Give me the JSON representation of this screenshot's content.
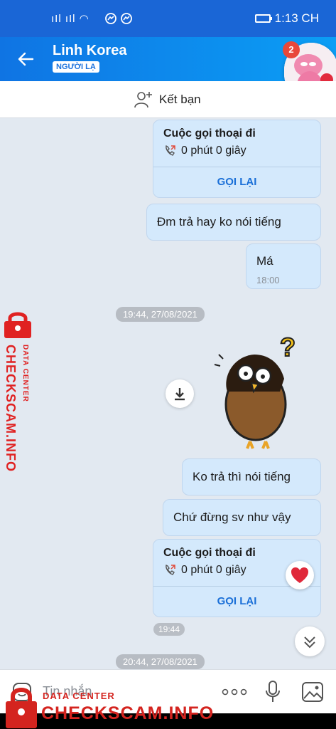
{
  "status_bar": {
    "time": "1:13 CH"
  },
  "header": {
    "contact_name": "Linh Korea",
    "stranger_tag": "NGƯỜI LẠ",
    "badge_count": "2"
  },
  "add_friend": {
    "label": "Kết bạn"
  },
  "messages": {
    "call1": {
      "title": "Cuộc gọi thoại đi",
      "duration": "0 phút 0 giây",
      "action": "GỌI LẠI"
    },
    "msg1": "Đm trả hay ko nói tiếng",
    "msg2": {
      "text": "Má",
      "time": "18:00"
    },
    "date1": "19:44, 27/08/2021",
    "msg3": "Ko trả thì nói tiếng",
    "msg4": "Chứ đừng sv như vậy",
    "call2": {
      "title": "Cuộc gọi thoại đi",
      "duration": "0 phút 0 giây",
      "action": "GỌI LẠI"
    },
    "time2": "19:44",
    "date2": "20:44, 27/08/2021"
  },
  "composer": {
    "placeholder": "Tin nhắn"
  },
  "watermark": {
    "small": "DATA CENTER",
    "large": "CHECKSCAM.INFO"
  },
  "colors": {
    "header": "#0f74e3",
    "bubble": "#d4e9fc",
    "callback": "#1a6fd7",
    "watermark": "#d4241f"
  }
}
